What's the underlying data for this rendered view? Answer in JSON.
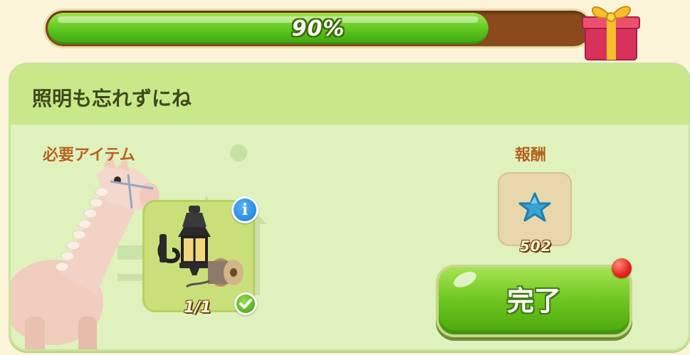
{
  "progress": {
    "percent_label": "90%",
    "fraction": 0.9,
    "reward_icon": "gift-box-icon"
  },
  "quest": {
    "title": "照明も忘れずにね",
    "required_label": "必要アイテム",
    "reward_label": "報酬",
    "character_image": "horse-image"
  },
  "required_item": {
    "icon": "street-lamp-with-cable-spool-icon",
    "count": "1/1",
    "info_icon": "info-icon",
    "status_icon": "check-icon"
  },
  "reward": {
    "icon": "blue-star-icon",
    "value": "502"
  },
  "actions": {
    "complete_label": "完了",
    "notification_icon": "red-notification-dot"
  },
  "colors": {
    "progress_fill": "#5cc61e",
    "progress_track": "#8a4a1c",
    "panel_bg": "#dff1bd",
    "header_bg": "#c8e88a",
    "label_brown": "#b0641d",
    "button_green": "#6dc41e"
  }
}
